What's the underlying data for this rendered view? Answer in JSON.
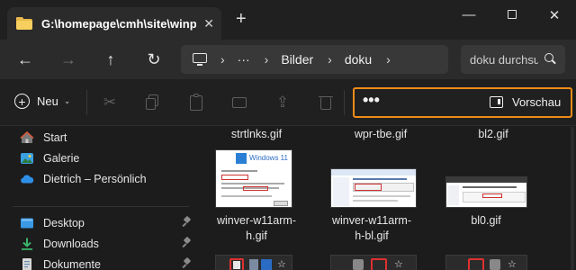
{
  "window": {
    "tab_title": "G:\\homepage\\cmh\\site\\winpro",
    "tab_close_glyph": "✕",
    "new_tab_glyph": "+",
    "minimize_glyph": "—",
    "close_glyph": "✕"
  },
  "nav": {
    "back_glyph": "←",
    "forward_glyph": "→",
    "up_glyph": "↑",
    "refresh_glyph": "↻",
    "breadcrumb": {
      "chevron": "›",
      "ellipsis": "···",
      "items": [
        "Bilder",
        "doku"
      ]
    },
    "search_placeholder": "doku durchsuchen"
  },
  "commands": {
    "new_label": "Neu",
    "new_caret": "⌄",
    "cut_glyph": "✂",
    "share_glyph": "⇪",
    "delete_glyph": "🗑",
    "more_glyph": "•••",
    "preview_label": "Vorschau",
    "highlight_color": "#f08c18"
  },
  "sidebar": {
    "quick": [
      {
        "label": "Start",
        "icon": "home-icon"
      },
      {
        "label": "Galerie",
        "icon": "gallery-icon"
      },
      {
        "label": "Dietrich – Persönlich",
        "icon": "onedrive-cloud-icon"
      }
    ],
    "pinned": [
      {
        "label": "Desktop",
        "icon": "desktop-icon"
      },
      {
        "label": "Downloads",
        "icon": "download-icon"
      },
      {
        "label": "Dokumente",
        "icon": "documents-icon"
      }
    ]
  },
  "files": {
    "top_row": [
      "strtlnks.gif",
      "wpr-tbe.gif",
      "bl2.gif"
    ],
    "mid_row": [
      {
        "name": "winver-w11arm-h.gif",
        "line1": "winver-w11arm-",
        "line2": "h.gif"
      },
      {
        "name": "winver-w11arm-h-bl.gif",
        "line1": "winver-w11arm-",
        "line2": "h-bl.gif"
      },
      {
        "name": "bl0.gif",
        "line1": "bl0.gif",
        "line2": ""
      }
    ],
    "thumb_text": {
      "windows11": "Windows 11"
    }
  }
}
